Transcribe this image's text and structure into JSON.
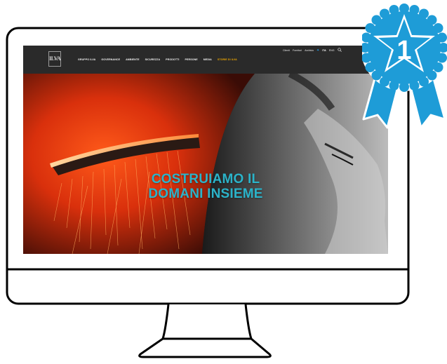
{
  "website": {
    "logo_text": "ILVA",
    "nav_items": [
      {
        "label": "GRUPPO ILVA"
      },
      {
        "label": "GOVERNANCE"
      },
      {
        "label": "AMBIENTE"
      },
      {
        "label": "SICUREZZA"
      },
      {
        "label": "PRODOTTI"
      },
      {
        "label": "PERSONE"
      },
      {
        "label": "MEDIA"
      },
      {
        "label": "STORIE DI ILVA",
        "highlight": true
      }
    ],
    "top_links": [
      "Clienti",
      "Fornitori",
      "Archivio"
    ],
    "language": "ITA",
    "language_alt": "ENG",
    "hero": {
      "title_line1": "COSTRUIAMO IL",
      "title_line2": "DOMANI INSIEME"
    }
  },
  "badge": {
    "number": "1"
  },
  "colors": {
    "hero_title": "#2bb3c9",
    "nav_highlight": "#f0a800",
    "badge_blue": "#1e9cd7",
    "navbar_bg": "#2a2a2a"
  },
  "icons": [
    "twitter-icon",
    "search-icon",
    "ribbon-badge-icon"
  ]
}
